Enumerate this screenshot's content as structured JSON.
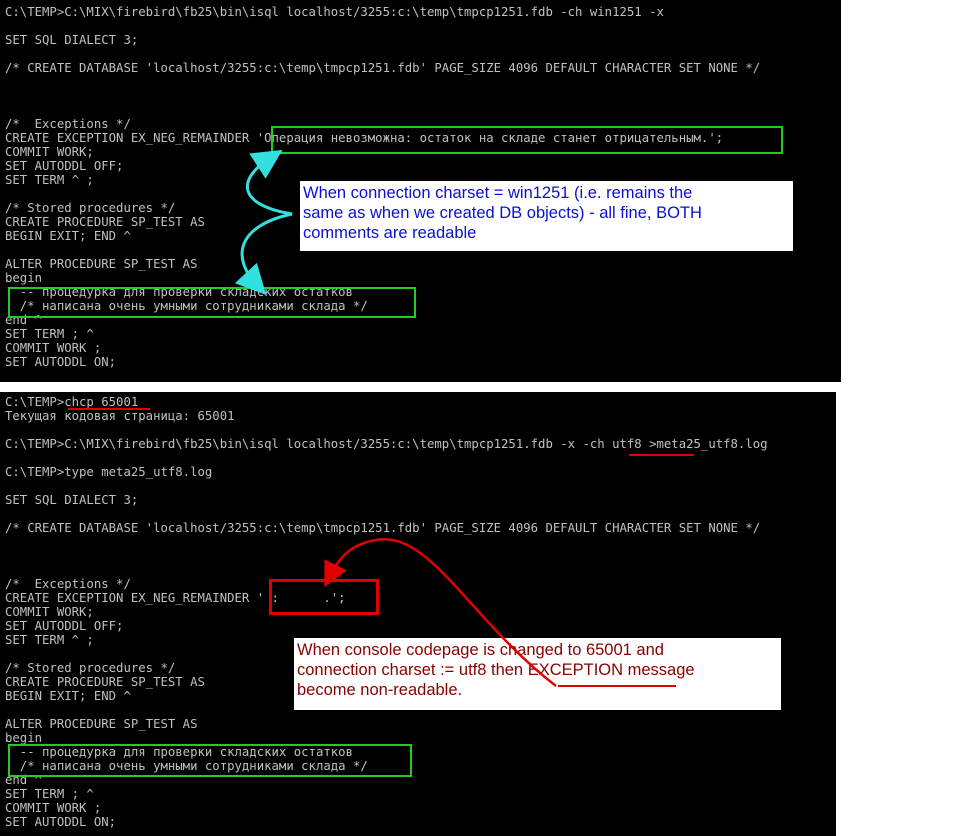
{
  "top_console": {
    "lines": [
      "C:\\TEMP>C:\\MIX\\firebird\\fb25\\bin\\isql localhost/3255:c:\\temp\\tmpcp1251.fdb -ch win1251 -x",
      "",
      "SET SQL DIALECT 3;",
      "",
      "/* CREATE DATABASE 'localhost/3255:c:\\temp\\tmpcp1251.fdb' PAGE_SIZE 4096 DEFAULT CHARACTER SET NONE */",
      "",
      "",
      "",
      "/*  Exceptions */",
      "CREATE EXCEPTION EX_NEG_REMAINDER 'Операция невозможна: остаток на складе станет отрицательным.';",
      "COMMIT WORK;",
      "SET AUTODDL OFF;",
      "SET TERM ^ ;",
      "",
      "/* Stored procedures */",
      "CREATE PROCEDURE SP_TEST AS",
      "BEGIN EXIT; END ^",
      "",
      "ALTER PROCEDURE SP_TEST AS",
      "begin",
      "  -- процедурка для проверки складских остатков",
      "  /* написана очень умными сотрудниками склада */",
      "end ^",
      "SET TERM ; ^",
      "COMMIT WORK ;",
      "SET AUTODDL ON;"
    ]
  },
  "bottom_console": {
    "lines": [
      "C:\\TEMP>chcp 65001",
      "Текущая кодовая страница: 65001",
      "",
      "C:\\TEMP>C:\\MIX\\firebird\\fb25\\bin\\isql localhost/3255:c:\\temp\\tmpcp1251.fdb -x -ch utf8 >meta25_utf8.log",
      "",
      "C:\\TEMP>type meta25_utf8.log",
      "",
      "SET SQL DIALECT 3;",
      "",
      "/* CREATE DATABASE 'localhost/3255:c:\\temp\\tmpcp1251.fdb' PAGE_SIZE 4096 DEFAULT CHARACTER SET NONE */",
      "",
      "",
      "",
      "/*  Exceptions */",
      "CREATE EXCEPTION EX_NEG_REMAINDER ' :      .';",
      "COMMIT WORK;",
      "SET AUTODDL OFF;",
      "SET TERM ^ ;",
      "",
      "/* Stored procedures */",
      "CREATE PROCEDURE SP_TEST AS",
      "BEGIN EXIT; END ^",
      "",
      "ALTER PROCEDURE SP_TEST AS",
      "begin",
      "  -- процедурка для проверки складских остатков",
      "  /* написана очень умными сотрудниками склада */",
      "end ^",
      "SET TERM ; ^",
      "COMMIT WORK ;",
      "SET AUTODDL ON;"
    ]
  },
  "callout_top": {
    "lines": [
      "When connection charset = win1251 (i.e. remains the",
      "same as when we created DB objects) - all fine, BOTH",
      "comments are readable"
    ]
  },
  "callout_bottom": {
    "lines": [
      "When console codepage is changed to 65001 and",
      "connection charset := utf8 then EXCEPTION message",
      "become non-readable."
    ]
  },
  "colors": {
    "console_bg": "#000000",
    "console_text": "#c0c0c0",
    "highlight_green": "#22cc22",
    "highlight_red": "#e00000",
    "arrow_cyan": "#33e0e0",
    "callout_blue_text": "#0a10d0",
    "callout_red_text": "#8a0000"
  }
}
